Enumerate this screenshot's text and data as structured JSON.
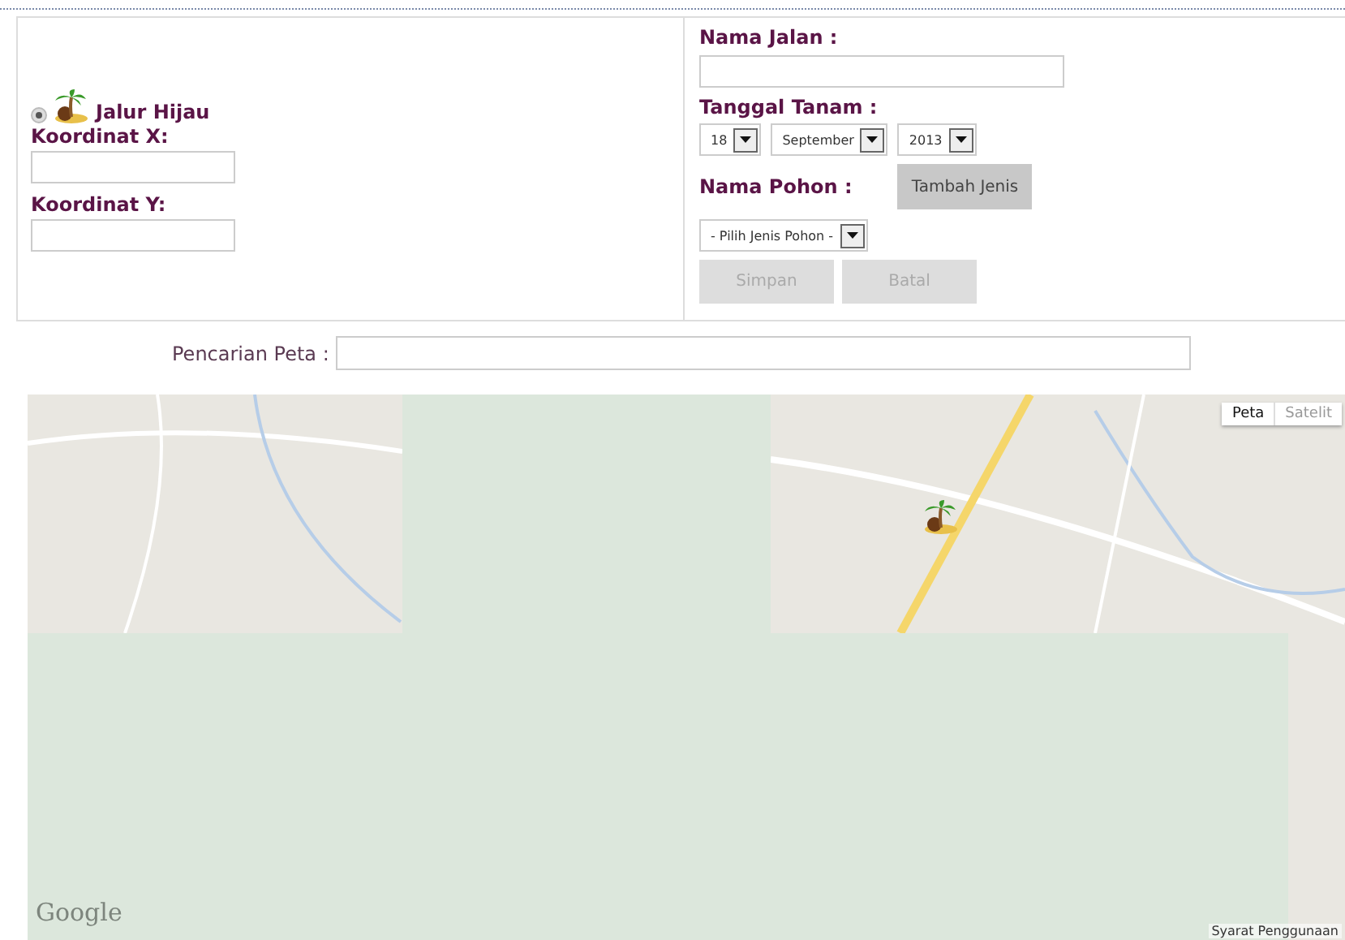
{
  "layer": {
    "label": "Jalur Hijau",
    "selected": true
  },
  "coord_x": {
    "label": "Koordinat X:"
  },
  "coord_y": {
    "label": "Koordinat Y:"
  },
  "street": {
    "label": "Nama Jalan :"
  },
  "plant_date": {
    "label": "Tanggal Tanam :",
    "day": "18",
    "month": "September",
    "year": "2013"
  },
  "tree": {
    "label": "Nama Pohon :",
    "add_button": "Tambah Jenis",
    "select": "- Pilih Jenis Pohon -"
  },
  "buttons": [
    {
      "label": "Simpan",
      "disabled": true
    },
    {
      "label": "Batal",
      "disabled": true
    }
  ],
  "map_search": {
    "label": "Pencarian Peta :"
  },
  "map": {
    "types": [
      {
        "label": "Peta",
        "selected": true
      },
      {
        "label": "Satelit",
        "selected": false
      }
    ],
    "logo": "Google",
    "terms": "Syarat Penggunaan"
  }
}
